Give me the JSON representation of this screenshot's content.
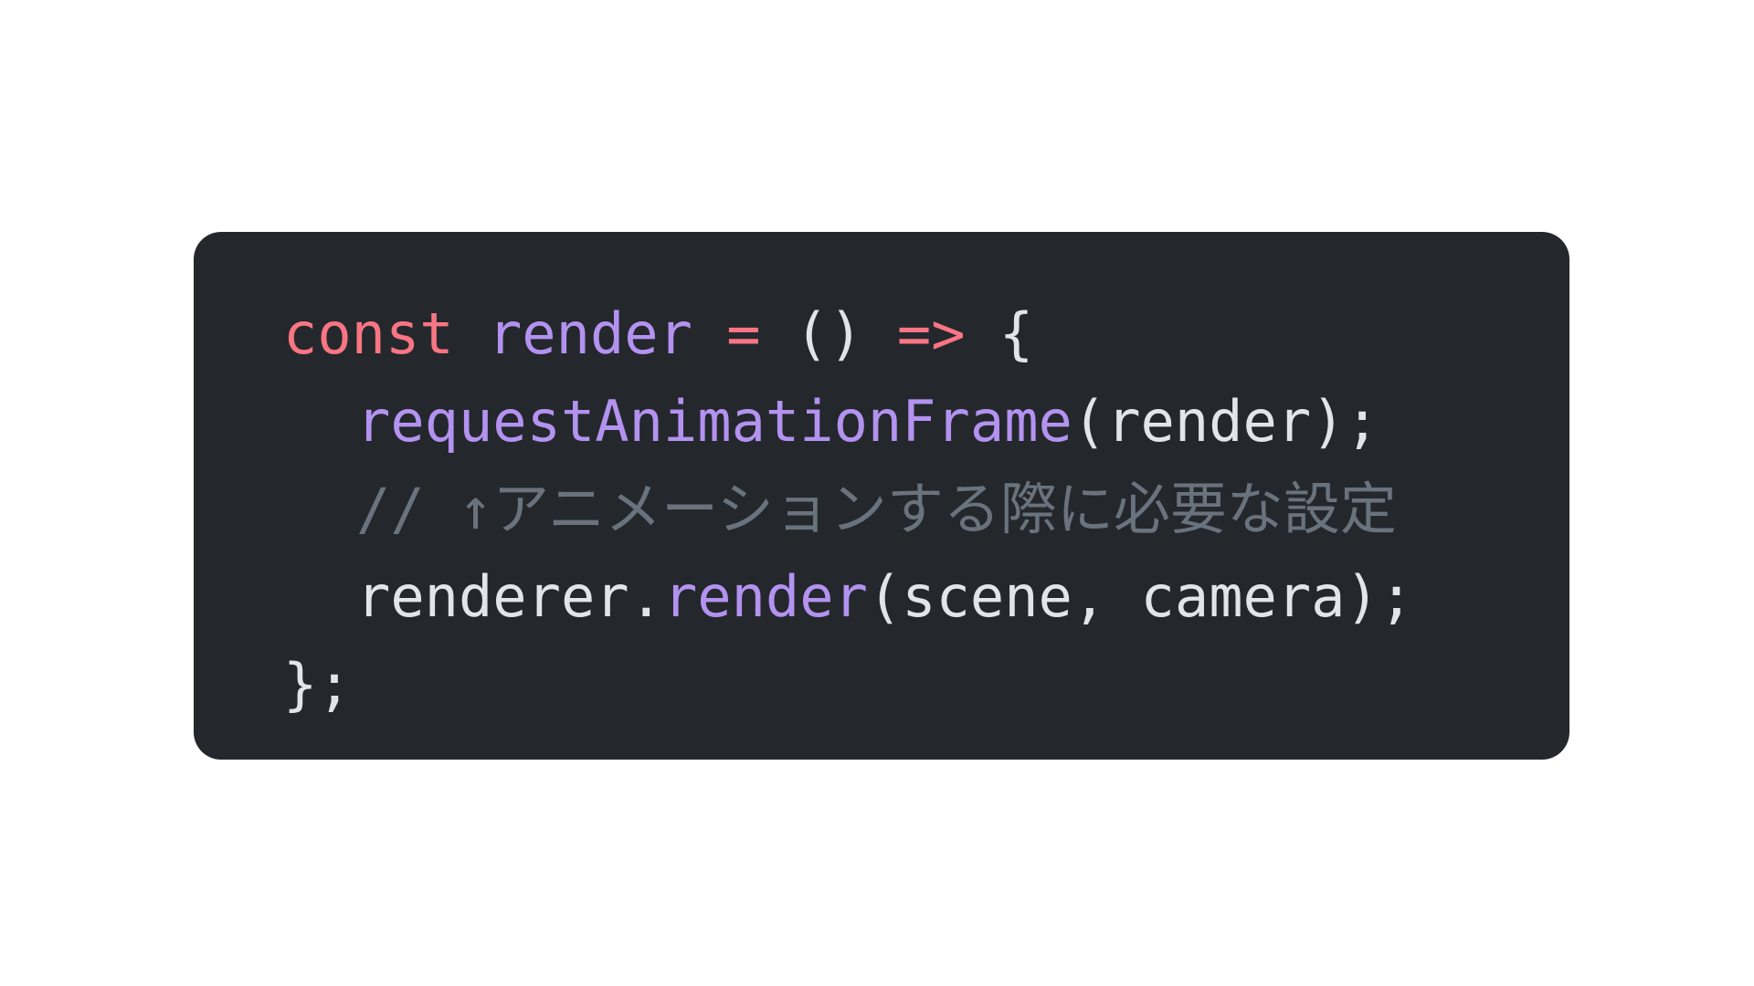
{
  "colors": {
    "page_background": "#ffffff",
    "code_background": "#24282d",
    "keyword": "#f97583",
    "function": "#b392f0",
    "plain": "#e1e4e8",
    "comment": "#6a737d"
  },
  "code": {
    "line1": {
      "kw_const": "const",
      "name_render": "render",
      "op_assign": "=",
      "parens": "()",
      "op_arrow": "=>",
      "brace_open": "{"
    },
    "line2": {
      "fn": "requestAnimationFrame",
      "args": "(render);"
    },
    "line3": {
      "comment": "// ↑アニメーションする際に必要な設定"
    },
    "line4": {
      "obj": "renderer.",
      "method": "render",
      "args": "(scene, camera);"
    },
    "line5": {
      "close": "};"
    }
  }
}
